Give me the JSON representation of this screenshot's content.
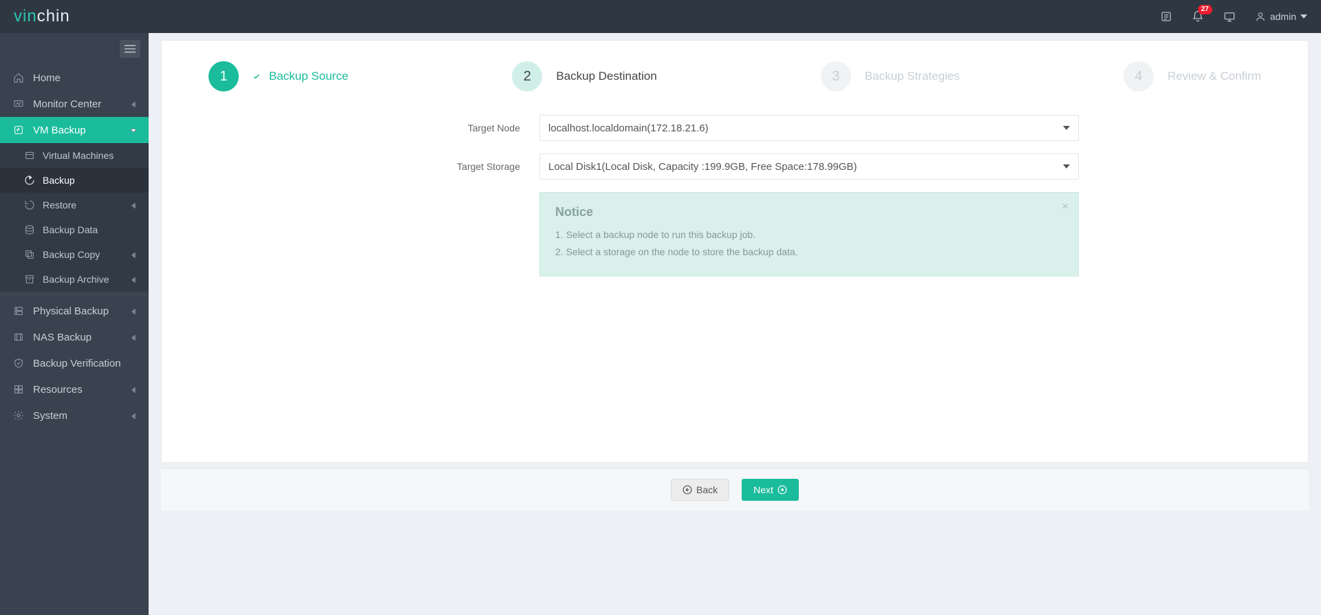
{
  "brand": {
    "part1": "vin",
    "part2": "chin"
  },
  "header": {
    "notifications_count": "27",
    "username": "admin"
  },
  "sidebar": {
    "items": {
      "home": "Home",
      "monitor": "Monitor Center",
      "vmbackup": "VM Backup",
      "physical": "Physical Backup",
      "nas": "NAS Backup",
      "verification": "Backup Verification",
      "resources": "Resources",
      "system": "System"
    },
    "vm_sub": {
      "virtualmachines": "Virtual Machines",
      "backup": "Backup",
      "restore": "Restore",
      "backupdata": "Backup Data",
      "backupcopy": "Backup Copy",
      "backuparchive": "Backup Archive"
    }
  },
  "wizard": {
    "s1": {
      "num": "1",
      "label": "Backup Source"
    },
    "s2": {
      "num": "2",
      "label": "Backup Destination"
    },
    "s3": {
      "num": "3",
      "label": "Backup Strategies"
    },
    "s4": {
      "num": "4",
      "label": "Review & Confirm"
    }
  },
  "form": {
    "target_node_label": "Target Node",
    "target_node_value": "localhost.localdomain(172.18.21.6)",
    "target_storage_label": "Target Storage",
    "target_storage_value": "Local Disk1(Local Disk, Capacity :199.9GB, Free Space:178.99GB)"
  },
  "notice": {
    "title": "Notice",
    "line1": "1. Select a backup node to run this backup job.",
    "line2": "2. Select a storage on the node to store the backup data."
  },
  "buttons": {
    "back": "Back",
    "next": "Next"
  }
}
